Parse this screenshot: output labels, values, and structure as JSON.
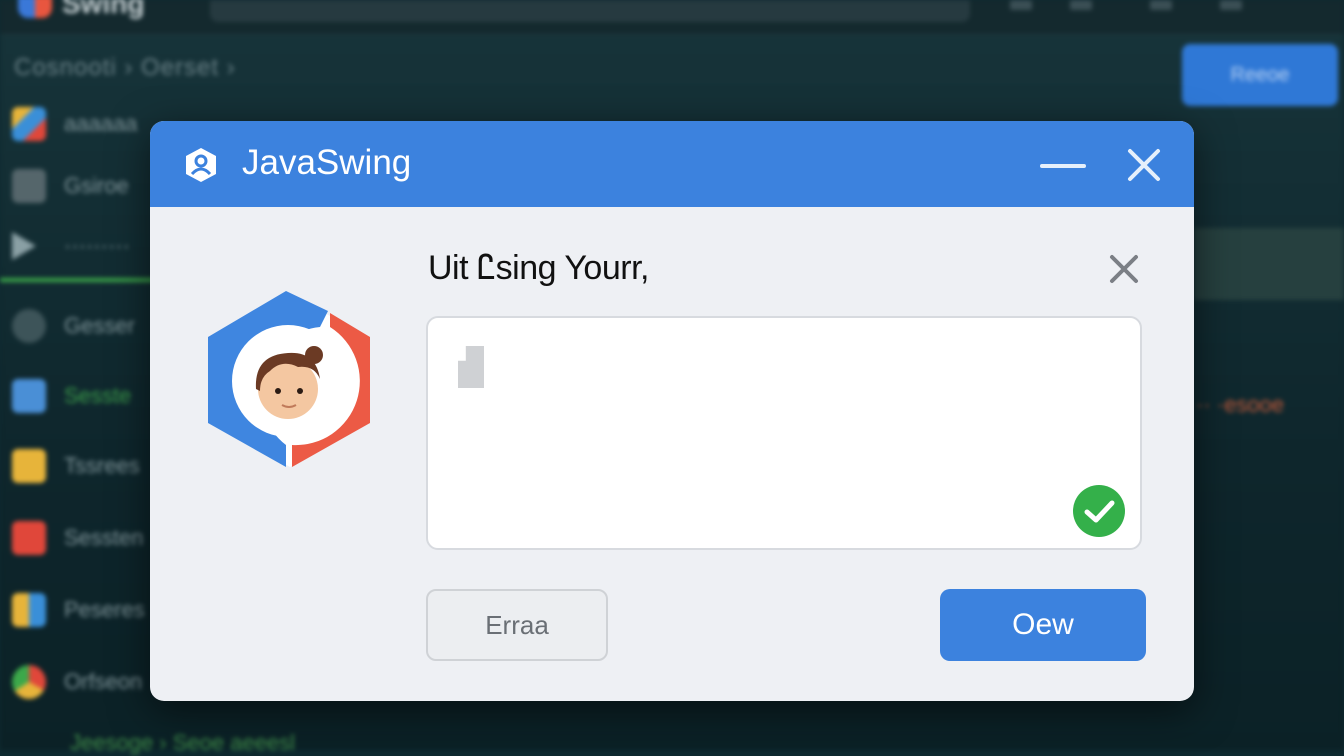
{
  "background_app": {
    "app_name": "Swing",
    "breadcrumb": "Cosnooti ›  Oerset ›",
    "top_button_label": "Reeoe",
    "sidebar": [
      {
        "label": "aaaaaa",
        "icon": "tools-icon",
        "color": "#3a8fd8"
      },
      {
        "label": "Gsiroe",
        "icon": "list-icon",
        "color": "#55666b"
      },
      {
        "label": "·········",
        "icon": "play-icon",
        "color": "#55666b"
      },
      {
        "label": "Gesser",
        "icon": "record-icon",
        "color": "#3d5459"
      },
      {
        "label": "Sesste",
        "icon": "edit-icon",
        "color": "#4a8fd6"
      },
      {
        "label": "Tssrees",
        "icon": "note-icon",
        "color": "#e7b43a"
      },
      {
        "label": "Sessten",
        "icon": "image-icon",
        "color": "#e0473a"
      },
      {
        "label": "Peseres",
        "icon": "grid-icon",
        "color": "#e7b43a"
      },
      {
        "label": "Orfseon",
        "icon": "chrome-icon",
        "color": "#d9533f"
      }
    ],
    "right_status": "·· ·esooe",
    "bottom_text": "Jeesoge ›  Seoe aeeesl"
  },
  "dialog": {
    "title": "JavaSwing",
    "title_icon": "user-shield-icon",
    "prompt": "Uit Ꮭsing Yourr,",
    "input": {
      "value": "",
      "placeholder": ""
    },
    "input_status_icon": "check-circle-icon",
    "secondary_button": "Erraa",
    "primary_button": "Oew",
    "colors": {
      "titlebar": "#3c82de",
      "primary_button": "#3c82de",
      "check": "#34b04a",
      "avatar_blue": "#3f86e0",
      "avatar_red": "#ec5a45"
    }
  }
}
